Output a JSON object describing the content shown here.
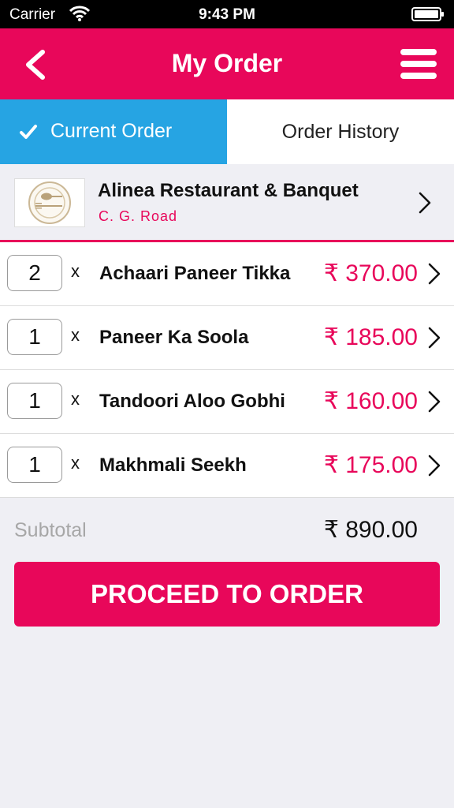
{
  "status_bar": {
    "carrier": "Carrier",
    "time": "9:43 PM"
  },
  "nav": {
    "title": "My Order"
  },
  "tabs": {
    "current": "Current Order",
    "history": "Order History"
  },
  "restaurant": {
    "name": "Alinea Restaurant & Banquet",
    "area": "C. G. Road"
  },
  "items": [
    {
      "qty": "2",
      "x": "x",
      "name": "Achaari Paneer Tikka",
      "price": "₹ 370.00"
    },
    {
      "qty": "1",
      "x": "x",
      "name": "Paneer Ka Soola",
      "price": "₹ 185.00"
    },
    {
      "qty": "1",
      "x": "x",
      "name": "Tandoori Aloo Gobhi",
      "price": "₹ 160.00"
    },
    {
      "qty": "1",
      "x": "x",
      "name": "Makhmali Seekh",
      "price": "₹ 175.00"
    }
  ],
  "subtotal": {
    "label": "Subtotal",
    "value": "₹ 890.00"
  },
  "actions": {
    "proceed_label": "PROCEED TO ORDER"
  },
  "colors": {
    "accent": "#e8075a",
    "tab_active": "#26a4e3",
    "background": "#efeff4"
  },
  "icons": {
    "back": "chevron-left-icon",
    "menu": "hamburger-menu-icon",
    "check": "checkmark-icon",
    "chevron": "chevron-right-icon",
    "logo": "plate-cutlery-icon"
  }
}
